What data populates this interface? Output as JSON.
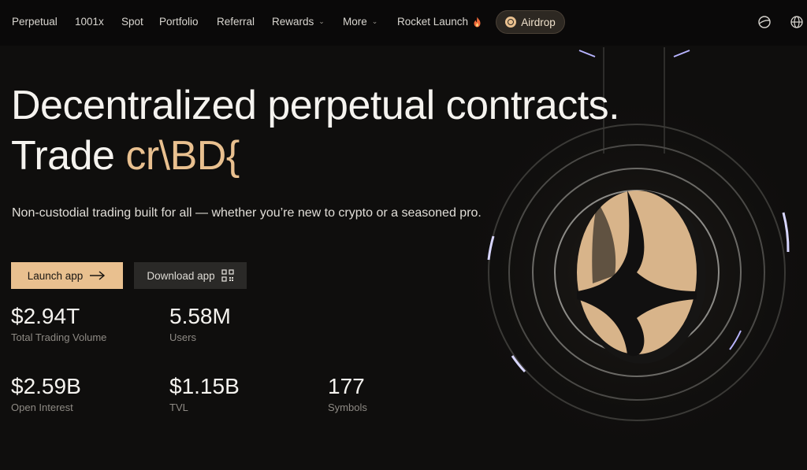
{
  "nav": {
    "items": [
      {
        "label": "Perpetual"
      },
      {
        "label": "1001x"
      },
      {
        "label": "Spot"
      },
      {
        "label": "Portfolio"
      },
      {
        "label": "Referral"
      },
      {
        "label": "Rewards",
        "chevron": "chevron-down-icon"
      },
      {
        "label": "More",
        "chevron": "chevron-down-icon"
      },
      {
        "label": "Rocket Launch",
        "icon": "flame-icon"
      }
    ],
    "airdrop_label": "Airdrop",
    "right_icons": [
      "theme-toggle-icon",
      "globe-icon"
    ]
  },
  "hero": {
    "headline_line1": "Decentralized perpetual contracts.",
    "headline_line2_prefix": "Trade ",
    "headline_line2_accent": "cr\\BD{",
    "subheadline": "Non-custodial trading built for all — whether you’re new to crypto or a seasoned pro.",
    "launch_label": "Launch app",
    "launch_icon": "arrow-right-icon",
    "download_label": "Download app",
    "download_icon": "qr-code-icon"
  },
  "stats": [
    {
      "value": "$2.94T",
      "label": "Total Trading Volume"
    },
    {
      "value": "5.58M",
      "label": "Users"
    },
    {
      "value": "$2.59B",
      "label": "Open Interest"
    },
    {
      "value": "$1.15B",
      "label": "TVL"
    },
    {
      "value": "177",
      "label": "Symbols"
    }
  ],
  "colors": {
    "background": "#0f0e0d",
    "accent": "#e9c08f",
    "button_secondary": "#2a2927",
    "muted_text": "#8e8a84"
  }
}
